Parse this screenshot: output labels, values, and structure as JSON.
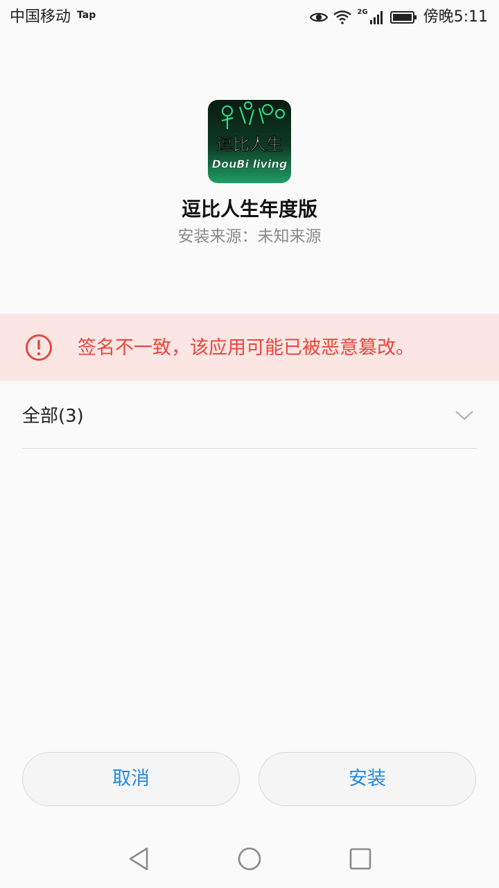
{
  "status_bar": {
    "carrier": "中国移动",
    "carrier_tag": "Tap",
    "network": "2G",
    "time": "傍晚5:11",
    "icons": [
      "eye-icon",
      "wifi-icon",
      "signal-icon",
      "battery-icon"
    ]
  },
  "app": {
    "name": "逗比人生年度版",
    "source": "安装来源：未知来源",
    "icon_text_cn": "逗比人生",
    "icon_text_en": "DouBi living"
  },
  "warning": {
    "icon": "alert-circle-icon",
    "text": "签名不一致，该应用可能已被恶意篡改。",
    "color": "#e8453c",
    "background": "#fce6e4"
  },
  "permissions": {
    "label": "全部(3)",
    "icon": "chevron-down-icon"
  },
  "buttons": {
    "cancel": "取消",
    "install": "安装",
    "accent": "#1e88e5"
  },
  "nav_bar": {
    "icons": [
      "back-icon",
      "home-icon",
      "recent-apps-icon"
    ]
  }
}
